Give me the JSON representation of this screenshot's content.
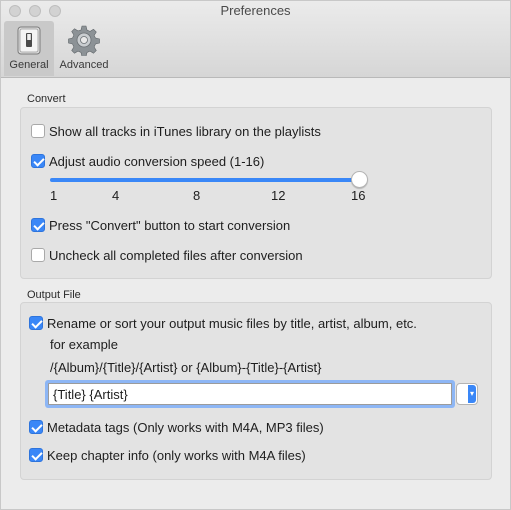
{
  "window": {
    "title": "Preferences"
  },
  "toolbar": {
    "general_label": "General",
    "advanced_label": "Advanced"
  },
  "convert": {
    "section_label": "Convert",
    "show_all_tracks": {
      "label": "Show all tracks in iTunes library on the playlists",
      "checked": false
    },
    "adjust_speed": {
      "label": "Adjust audio conversion speed (1-16)",
      "checked": true
    },
    "slider": {
      "ticks": [
        "1",
        "4",
        "8",
        "12",
        "16"
      ],
      "value": 16,
      "min": 1,
      "max": 16
    },
    "press_convert": {
      "label": "Press \"Convert\" button to start conversion",
      "checked": true
    },
    "uncheck_completed": {
      "label": "Uncheck all completed files after conversion",
      "checked": false
    }
  },
  "output": {
    "section_label": "Output File",
    "rename": {
      "label": "Rename or sort your output music files by title, artist, album, etc.",
      "checked": true
    },
    "for_example": "for example",
    "example_pattern": "/{Album}/{Title}/{Artist} or {Album}-{Title}-{Artist}",
    "format_value": "{Title} {Artist}",
    "metadata": {
      "label": "Metadata tags (Only works with M4A, MP3 files)",
      "checked": true
    },
    "chapter": {
      "label": "Keep chapter info (only works with  M4A files)",
      "checked": true
    }
  },
  "colors": {
    "accent": "#3a87f7",
    "window_bg": "#ececec",
    "group_bg": "#e3e3e3"
  },
  "icons": {
    "general": "switch-icon",
    "advanced": "gear-icon"
  }
}
